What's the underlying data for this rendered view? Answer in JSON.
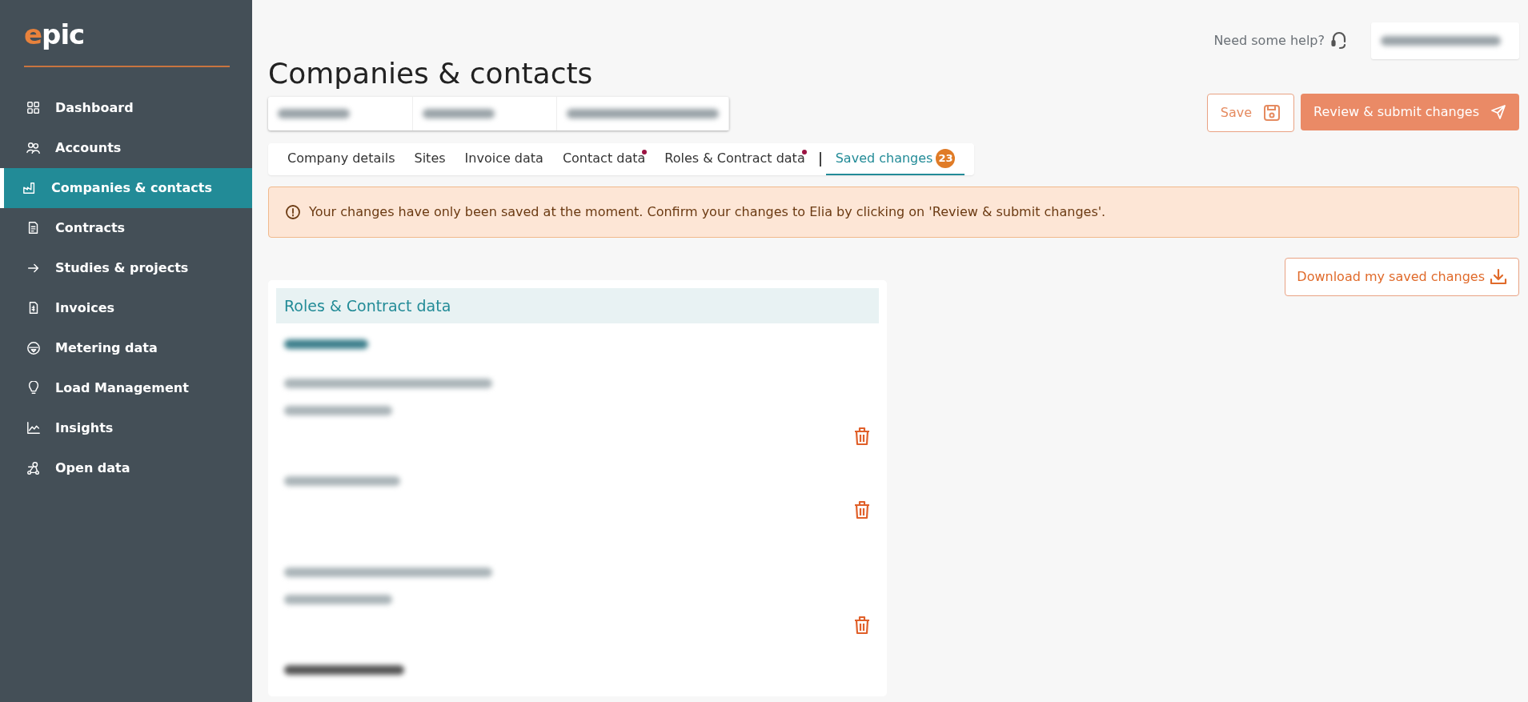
{
  "sidebar": {
    "logo": "epic",
    "items": [
      {
        "label": "Dashboard",
        "selected": false
      },
      {
        "label": "Accounts",
        "selected": false
      },
      {
        "label": "Companies & contacts",
        "selected": true
      },
      {
        "label": "Contracts",
        "selected": false
      },
      {
        "label": "Studies & projects",
        "selected": false
      },
      {
        "label": "Invoices",
        "selected": false
      },
      {
        "label": "Metering data",
        "selected": false
      },
      {
        "label": "Load Management",
        "selected": false
      },
      {
        "label": "Insights",
        "selected": false
      },
      {
        "label": "Open data",
        "selected": false
      }
    ]
  },
  "header": {
    "help": "Need some help?"
  },
  "page_title": "Companies & contacts",
  "actions": {
    "save": "Save",
    "submit": "Review & submit changes"
  },
  "tabs": [
    {
      "label": "Company details",
      "selected": false,
      "changed": false
    },
    {
      "label": "Sites",
      "selected": false,
      "changed": false
    },
    {
      "label": "Invoice data",
      "selected": false,
      "changed": false
    },
    {
      "label": "Contact data",
      "selected": false,
      "changed": true
    },
    {
      "label": "Roles & Contract data",
      "selected": false,
      "changed": true
    },
    {
      "label": "Saved changes",
      "selected": true,
      "changed": false,
      "badge": "23"
    }
  ],
  "alert": "Your changes have only been saved at the moment. Confirm your changes to Elia by clicking on 'Review & submit changes'.",
  "download": "Download my saved changes",
  "card": {
    "title": "Roles & Contract data",
    "entries": [
      {
        "kind": "updated"
      },
      {
        "kind": "deleted"
      },
      {
        "kind": "updated"
      }
    ]
  }
}
